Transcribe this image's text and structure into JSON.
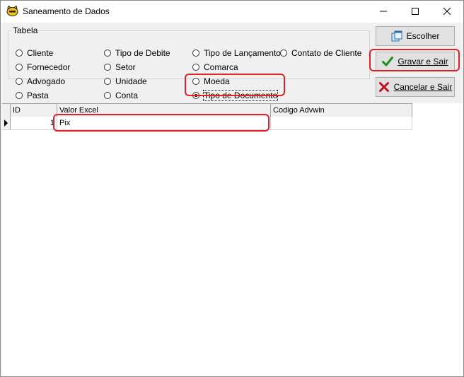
{
  "window": {
    "title": "Saneamento de Dados"
  },
  "group": {
    "legend": "Tabela",
    "options": [
      {
        "label": "Cliente",
        "checked": false
      },
      {
        "label": "Fornecedor",
        "checked": false
      },
      {
        "label": "Advogado",
        "checked": false
      },
      {
        "label": "Pasta",
        "checked": false
      },
      {
        "label": "Tipo de Debite",
        "checked": false
      },
      {
        "label": "Setor",
        "checked": false
      },
      {
        "label": "Unidade",
        "checked": false
      },
      {
        "label": "Conta",
        "checked": false
      },
      {
        "label": "Tipo de Lançamento",
        "checked": false
      },
      {
        "label": "Comarca",
        "checked": false
      },
      {
        "label": "Moeda",
        "checked": false
      },
      {
        "label": "Tipo de Documento",
        "checked": true
      },
      {
        "label": "Contato de Cliente",
        "checked": false
      }
    ]
  },
  "buttons": {
    "escolher": "Escolher",
    "gravar": "Gravar e Sair",
    "cancelar": "Cancelar e Sair"
  },
  "grid": {
    "columns": [
      "ID",
      "Valor Excel",
      "Codigo Advwin"
    ],
    "rows": [
      {
        "id": "1",
        "valor_excel": "Pix",
        "codigo_advwin": ""
      }
    ]
  },
  "colors": {
    "highlight": "#e0202a",
    "check_green": "#1e8e1e",
    "cancel_red": "#c0121b"
  }
}
